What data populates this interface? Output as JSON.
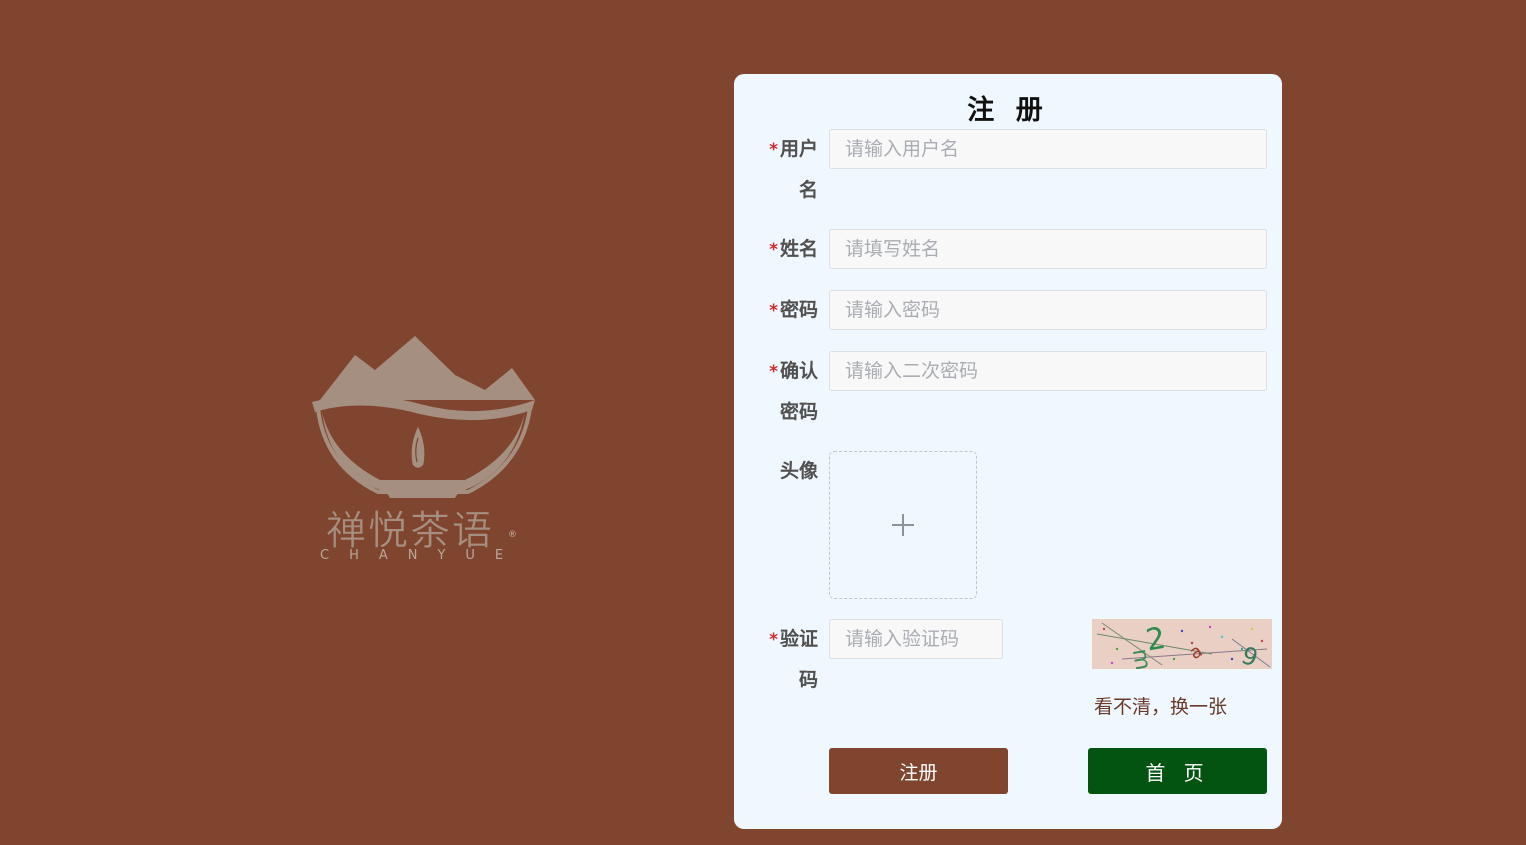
{
  "logo": {
    "cn_text": "禅悦茶语",
    "en_text": "CHANYUE",
    "mark": "®"
  },
  "form": {
    "title": "注 册",
    "fields": {
      "username": {
        "required_mark": "*",
        "label_line1": "用户",
        "label_line2": "名",
        "placeholder": "请输入用户名"
      },
      "name": {
        "required_mark": "*",
        "label": "姓名",
        "placeholder": "请填写姓名"
      },
      "password": {
        "required_mark": "*",
        "label": "密码",
        "placeholder": "请输入密码"
      },
      "confirm": {
        "required_mark": "*",
        "label_line1": "确认",
        "label_line2": "密码",
        "placeholder": "请输入二次密码"
      },
      "avatar": {
        "label": "头像",
        "upload_icon": "plus-icon"
      },
      "captcha": {
        "required_mark": "*",
        "label_line1": "验证",
        "label_line2": "码",
        "placeholder": "请输入验证码",
        "refresh_text": "看不清，换一张"
      }
    },
    "buttons": {
      "register": "注册",
      "home": "首 页"
    }
  },
  "colors": {
    "background": "#80452e",
    "panel": "#eff7ff",
    "register_button": "#80452e",
    "home_button": "#045411",
    "required": "#d12a2a"
  }
}
